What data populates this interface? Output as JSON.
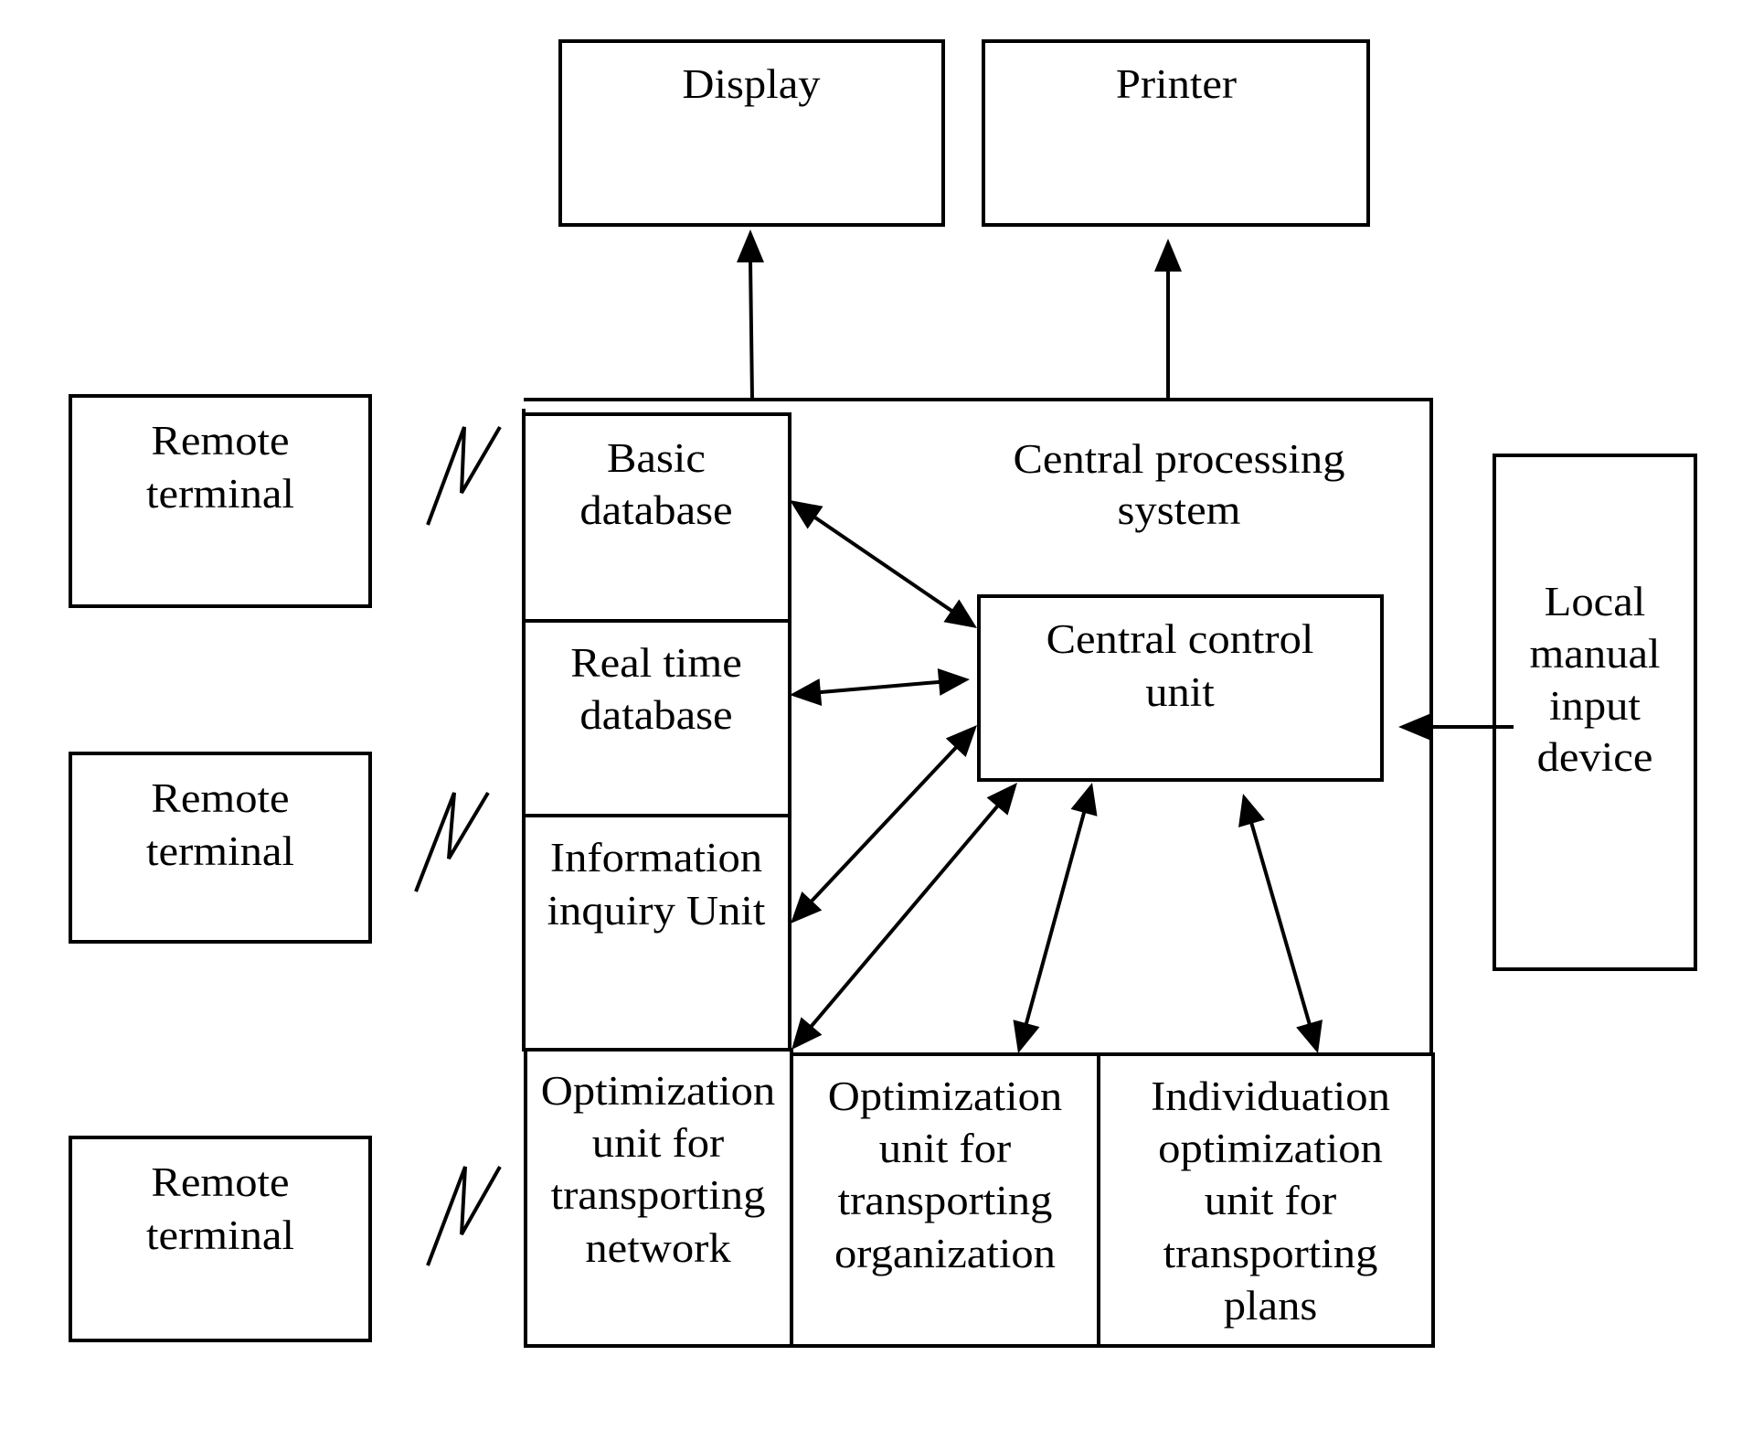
{
  "colors": {
    "line": "#000000",
    "background": "#ffffff"
  },
  "display": {
    "label": "Display"
  },
  "printer": {
    "label": "Printer"
  },
  "remote_terminals": [
    {
      "lines": [
        "Remote",
        "terminal"
      ]
    },
    {
      "lines": [
        "Remote",
        "terminal"
      ]
    },
    {
      "lines": [
        "Remote",
        "terminal"
      ]
    }
  ],
  "central_processing_system": {
    "lines": [
      "Central processing",
      "system"
    ],
    "central_control_unit": {
      "lines": [
        "Central control",
        "unit"
      ]
    },
    "left_units": [
      {
        "lines": [
          "Basic",
          "database"
        ]
      },
      {
        "lines": [
          "Real time",
          "database"
        ]
      },
      {
        "lines": [
          "Information",
          "inquiry Unit"
        ]
      }
    ],
    "bottom_units": [
      {
        "lines": [
          "Optimization",
          "unit for",
          "transporting",
          "network"
        ]
      },
      {
        "lines": [
          "Optimization",
          "unit for",
          "transporting",
          "organization"
        ]
      },
      {
        "lines": [
          "Individuation",
          "optimization",
          "unit for",
          "transporting",
          "plans"
        ]
      }
    ]
  },
  "local_input": {
    "lines": [
      "Local",
      "manual",
      "input",
      "device"
    ]
  },
  "connections": [
    {
      "from": "central-processing-system",
      "to": "display",
      "type": "one-way"
    },
    {
      "from": "central-processing-system",
      "to": "printer",
      "type": "one-way"
    },
    {
      "from": "local-manual-input-device",
      "to": "central-control-unit",
      "type": "one-way"
    },
    {
      "from": "central-control-unit",
      "to": "basic-database",
      "type": "two-way"
    },
    {
      "from": "central-control-unit",
      "to": "real-time-database",
      "type": "two-way"
    },
    {
      "from": "central-control-unit",
      "to": "information-inquiry-unit",
      "type": "two-way"
    },
    {
      "from": "central-control-unit",
      "to": "optimization-unit-transporting-network",
      "type": "two-way"
    },
    {
      "from": "central-control-unit",
      "to": "optimization-unit-transporting-organization",
      "type": "two-way"
    },
    {
      "from": "central-control-unit",
      "to": "individuation-optimization-unit-transporting-plans",
      "type": "two-way"
    },
    {
      "from": "remote-terminal-1",
      "to": "central-processing-system",
      "type": "wireless"
    },
    {
      "from": "remote-terminal-2",
      "to": "central-processing-system",
      "type": "wireless"
    },
    {
      "from": "remote-terminal-3",
      "to": "central-processing-system",
      "type": "wireless"
    }
  ]
}
